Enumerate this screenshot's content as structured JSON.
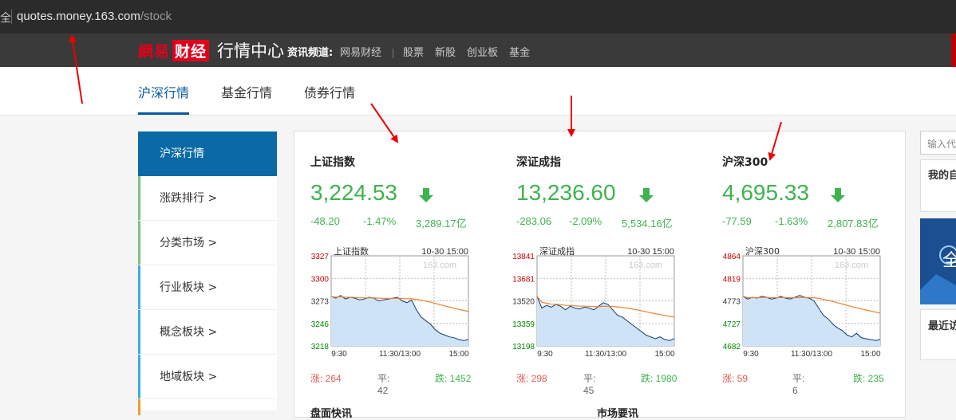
{
  "browser": {
    "lead_text": "全",
    "url_domain": "quotes.money.163.com",
    "url_path": "/stock"
  },
  "header": {
    "logo_text": "網易",
    "logo_box": "财经",
    "title": "行情中心",
    "channel_label": "资讯频道:",
    "links": [
      "网易财经",
      "股票",
      "新股",
      "创业板",
      "基金"
    ]
  },
  "tabs": [
    "沪深行情",
    "基金行情",
    "债券行情"
  ],
  "sidebar": {
    "items": [
      {
        "label": "沪深行情"
      },
      {
        "label": "涨跌排行 >"
      },
      {
        "label": "分类市场 >"
      },
      {
        "label": "行业板块 >"
      },
      {
        "label": "概念板块 >"
      },
      {
        "label": "地域板块 >"
      }
    ],
    "colors": [
      "#0a6aa6",
      "#7cc47c",
      "#7cc47c",
      "#3ab0d8",
      "#3ab0d8",
      "#3ab0d8"
    ]
  },
  "indices": [
    {
      "name": "上证指数",
      "value": "3,224.53",
      "change": "-48.20",
      "pct": "-1.47%",
      "amount": "3,289.17亿",
      "chart_title": "上证指数",
      "chart_time": "10-30 15:00",
      "watermark": "163.com",
      "y_ticks": [
        "3327",
        "3300",
        "3273",
        "3246",
        "3218"
      ],
      "x_ticks": [
        "9:30",
        "11:30/13:00",
        "15:00"
      ],
      "up_label": "涨: 264",
      "flat_label": "平: 42",
      "down_label": "跌: 1452"
    },
    {
      "name": "深证成指",
      "value": "13,236.60",
      "change": "-283.06",
      "pct": "-2.09%",
      "amount": "5,534.16亿",
      "chart_title": "深证成指",
      "chart_time": "10-30 15:00",
      "watermark": "163.com",
      "y_ticks": [
        "13841",
        "13681",
        "13520",
        "13359",
        "13198"
      ],
      "x_ticks": [
        "9:30",
        "11:30/13:00",
        "15:00"
      ],
      "up_label": "涨: 298",
      "flat_label": "平: 45",
      "down_label": "跌: 1980"
    },
    {
      "name": "沪深300",
      "value": "4,695.33",
      "change": "-77.59",
      "pct": "-1.63%",
      "amount": "2,807.83亿",
      "chart_title": "沪深300",
      "chart_time": "10-30 15:00",
      "watermark": "163.com",
      "y_ticks": [
        "4864",
        "4819",
        "4773",
        "4727",
        "4682"
      ],
      "x_ticks": [
        "9:30",
        "11:30/13:00",
        "15:00"
      ],
      "up_label": "涨: 59",
      "flat_label": "平: 6",
      "down_label": "跌: 235"
    }
  ],
  "sections": [
    "盘面快讯",
    "市场要讯"
  ],
  "right": {
    "search_placeholder": "输入代码",
    "my_title": "我的自选",
    "recent_title": "最近访问",
    "ad_text": "全"
  },
  "colors": {
    "down_green": "#3fb34f",
    "up_red": "#e05a5a",
    "brand_red": "#e1001c",
    "accent_blue": "#0a5aa0"
  }
}
